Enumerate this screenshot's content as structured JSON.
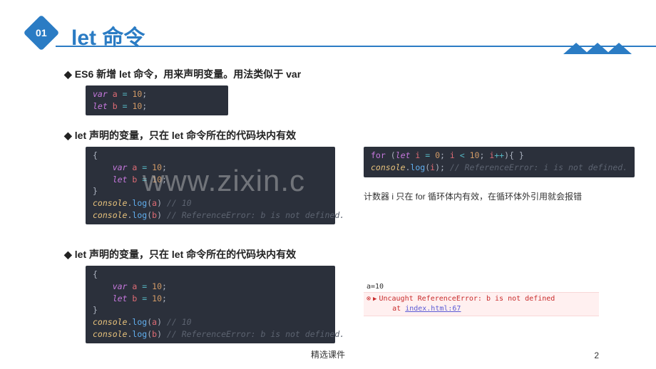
{
  "header": {
    "badge": "01",
    "title": "let 命令"
  },
  "sections": {
    "s1": {
      "bullet": "ES6 新增 let 命令，用来声明变量。用法类似于 var"
    },
    "s2": {
      "bullet": "let 声明的变量，只在 let 命令所在的代码块内有效",
      "caption_right": "计数器 i 只在 for 循环体内有效，在循环体外引用就会报错"
    },
    "s3": {
      "bullet": "let 声明的变量，只在 let 命令所在的代码块内有效",
      "devtools": {
        "line1": "a=10",
        "err1": "Uncaught ReferenceError: b is not defined",
        "err2_pre": "at ",
        "err2_link": "index.html:67"
      }
    }
  },
  "code": {
    "block1": {
      "l1_var": "var",
      "l1_a": "a",
      "l1_eq": " = ",
      "l1_10": "10",
      "l1_sc": ";",
      "l2_let": "let",
      "l2_b": "b",
      "l2_eq": " = ",
      "l2_10": "10",
      "l2_sc": ";"
    },
    "block2": {
      "l1_open": "{",
      "l2_var": "var",
      "l2_a": "a",
      "l2_eq": " = ",
      "l2_10": "10",
      "l2_sc": ";",
      "l3_let": "let",
      "l3_b": "b",
      "l3_eq": " = ",
      "l3_10": "10",
      "l3_sc": ";",
      "l4_close": "}",
      "l5_obj": "console",
      "l5_dot": ".",
      "l5_fn": "log",
      "l5_open": "(",
      "l5_arg": "a",
      "l5_close": ")",
      "l5_cmt": " // 10",
      "l6_obj": "console",
      "l6_dot": ".",
      "l6_fn": "log",
      "l6_open": "(",
      "l6_arg": "b",
      "l6_close": ")",
      "l6_cmt": " // ReferenceError: b is not defined."
    },
    "block3": {
      "l1_for": "for",
      "l1_open": " (",
      "l1_let": "let",
      "l1_sp": " ",
      "l1_i1": "i",
      "l1_eq": " = ",
      "l1_0": "0",
      "l1_sc1": "; ",
      "l1_i2": "i",
      "l1_lt": " < ",
      "l1_10": "10",
      "l1_sc2": "; ",
      "l1_i3": "i",
      "l1_pp": "++",
      "l1_close": "){ }",
      "l2_obj": "console",
      "l2_dot": ".",
      "l2_fn": "log",
      "l2_open": "(",
      "l2_arg": "i",
      "l2_close": ");",
      "l2_cmt": " // ReferenceError: i is not defined."
    }
  },
  "watermark": "www.zixin.c",
  "footer": {
    "center": "精选课件",
    "page": "2"
  }
}
